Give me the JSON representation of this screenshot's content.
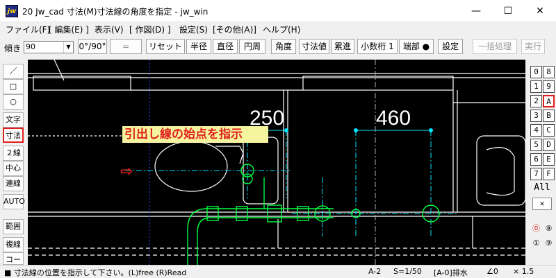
{
  "window": {
    "title": "20 Jw_cad 寸法(M)寸法線の角度を指定 - jw_win",
    "app_icon": "jw",
    "minimize": "—",
    "maximize": "☐",
    "close": "✕"
  },
  "menu": [
    "ファイル(F)",
    "[ 編集(E) ]",
    "表示(V)",
    "[ 作図(D) ]",
    "設定(S)",
    "[その他(A)]",
    "ヘルプ(H)"
  ],
  "toolbar": {
    "angle_label": "傾き",
    "angle_value": "90",
    "buttons": [
      "0°/90°",
      "=",
      "リセット",
      "半径",
      "直径",
      "円周",
      "角度",
      "寸法値",
      "累進",
      "小数桁 1",
      "端部 ●",
      "設定"
    ],
    "disabled": [
      "一括処理",
      "実行"
    ]
  },
  "left_tools": [
    "／",
    "□",
    "○",
    "文字",
    "寸法",
    "２線",
    "中心線",
    "連線",
    "AUTO",
    "範囲",
    "複線",
    "コーナー"
  ],
  "right_layers": [
    "0",
    "8",
    "1",
    "9",
    "2",
    "A",
    "3",
    "B",
    "4",
    "C",
    "5",
    "D",
    "6",
    "E",
    "7",
    "F",
    "All",
    "✕",
    "⓪",
    "⑧",
    "①",
    "⑨"
  ],
  "canvas": {
    "dim_label_1": "250",
    "dim_label_2": "460",
    "tooltip": "引出し線の始点を指示",
    "arrow": "⇨"
  },
  "status": {
    "message": "■  寸法線の位置を指示して下さい。(L)free  (R)Read",
    "layer": "A-2",
    "scale": "S=1/50",
    "layer_name": "[A-0]排水",
    "angle": "∠0",
    "factor": "× 1.5"
  },
  "colors": {
    "canvas_bg": "#000000",
    "green": "#00ff44",
    "cyan": "#00e5ff",
    "white": "#ffffff",
    "red": "#e0201c",
    "tooltip_bg": "#f5f5a0"
  }
}
